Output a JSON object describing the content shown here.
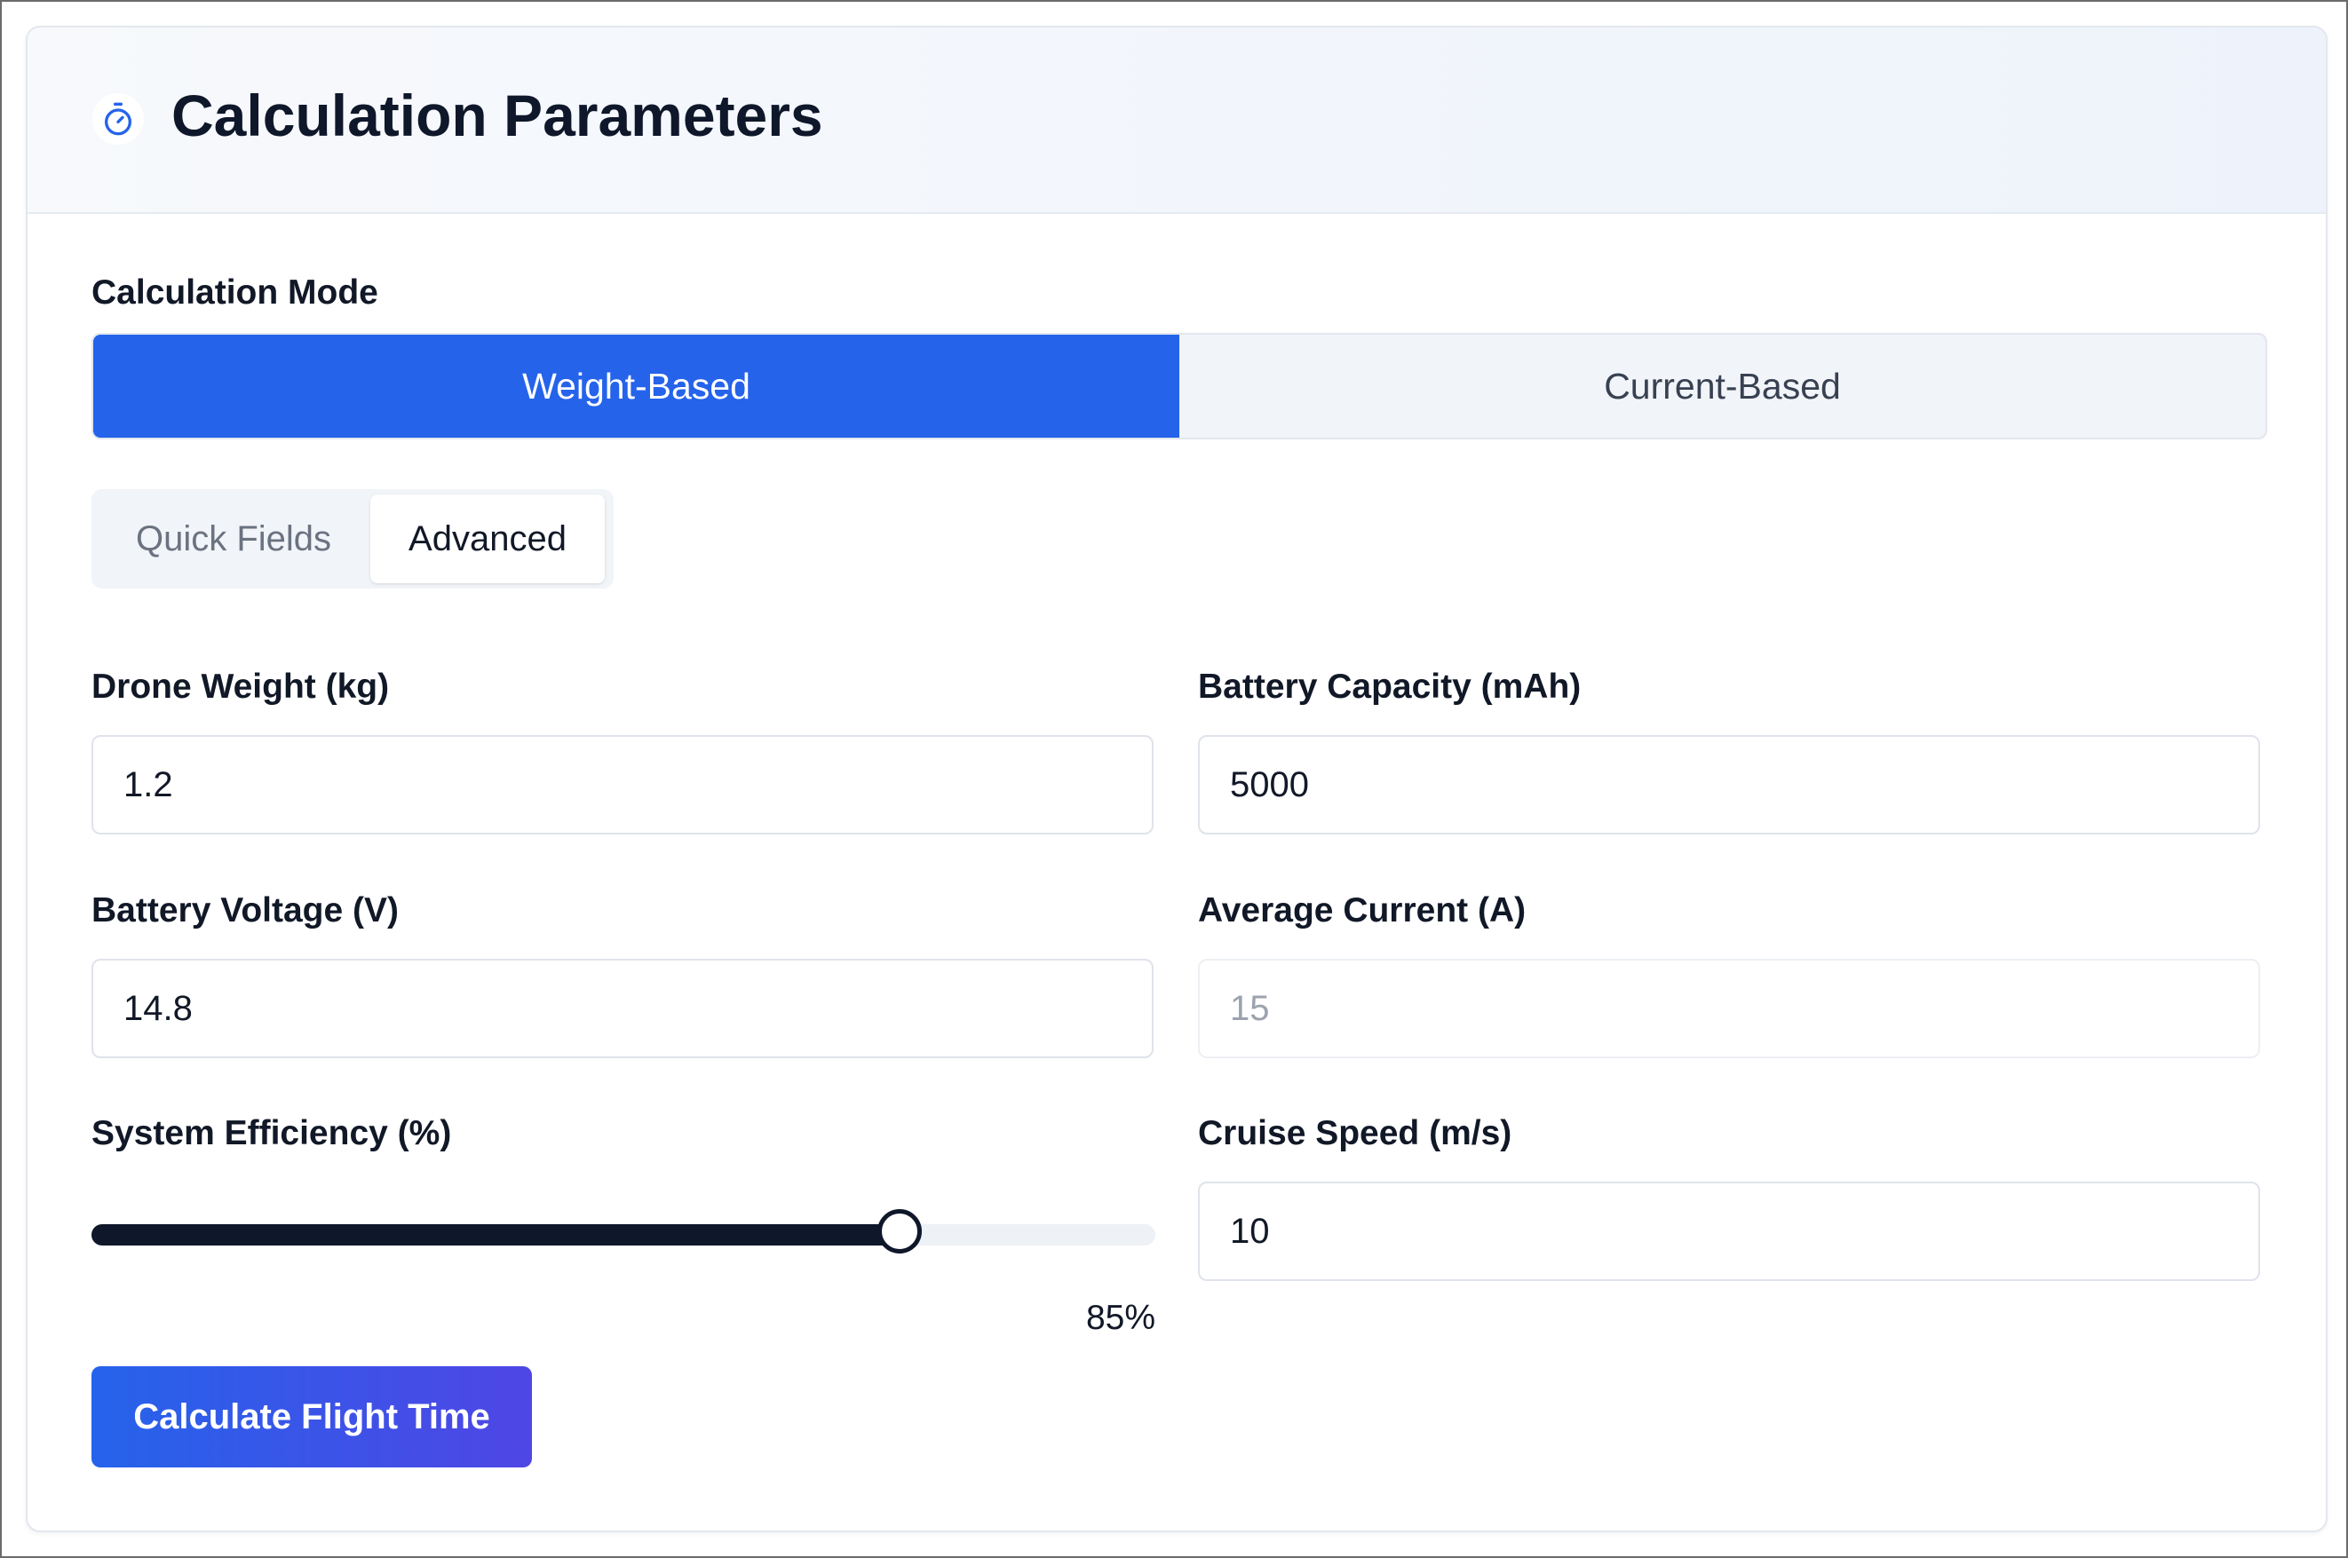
{
  "header": {
    "title": "Calculation Parameters",
    "icon": "stopwatch-icon",
    "icon_color": "#2563eb"
  },
  "mode": {
    "label": "Calculation Mode",
    "options": [
      "Weight-Based",
      "Current-Based"
    ],
    "selected": "Weight-Based",
    "accent": "#2563eb"
  },
  "subtabs": {
    "items": [
      "Quick Fields",
      "Advanced"
    ],
    "selected": "Advanced"
  },
  "fields": {
    "drone_weight": {
      "label": "Drone Weight (kg)",
      "value": "1.2"
    },
    "battery_capacity": {
      "label": "Battery Capacity (mAh)",
      "value": "5000"
    },
    "battery_voltage": {
      "label": "Battery Voltage (V)",
      "value": "14.8"
    },
    "average_current": {
      "label": "Average Current (A)",
      "value": "15",
      "disabled": true
    },
    "cruise_speed": {
      "label": "Cruise Speed (m/s)",
      "value": "10"
    }
  },
  "efficiency": {
    "label": "System Efficiency (%)",
    "value_text": "85%",
    "fraction": 0.76
  },
  "calculate_button": {
    "label": "Calculate Flight Time"
  }
}
